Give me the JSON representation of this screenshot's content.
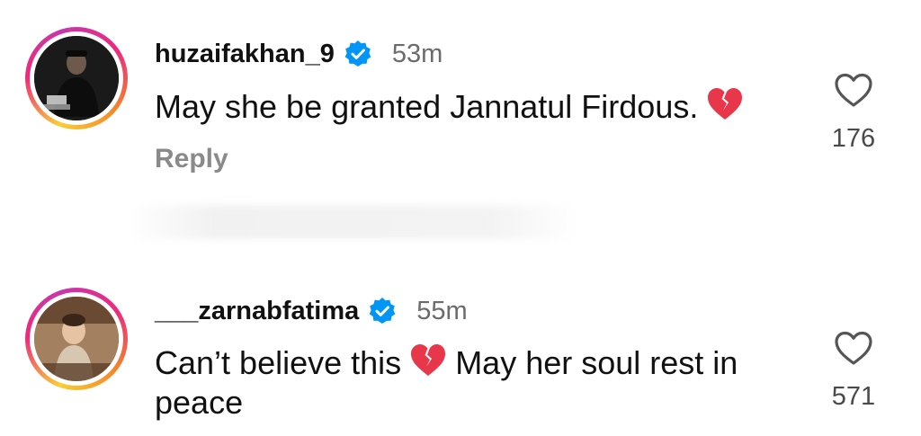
{
  "comments": [
    {
      "username": "huzaifakhan_9",
      "verified": true,
      "time": "53m",
      "text": "May she be granted Jannatul Firdous.",
      "reply_label": "Reply",
      "like_count": "176",
      "avatar_icon": "user-photo-dark"
    },
    {
      "username": "___zarnabfatima",
      "verified": true,
      "time": "55m",
      "text_part1": "Can’t believe this",
      "text_part2": "May her soul rest in peace",
      "like_count": "571",
      "avatar_icon": "user-photo-child"
    }
  ],
  "colors": {
    "verified_blue": "#0095f6",
    "broken_heart_red": "#e8364a",
    "muted_text": "#6b6b6b"
  }
}
